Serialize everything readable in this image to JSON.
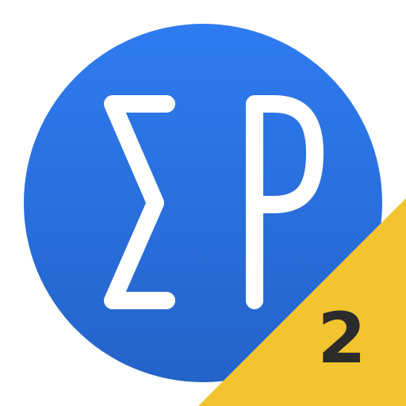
{
  "app_icon": {
    "logo_text": "ΣP",
    "badge_number": "2",
    "colors": {
      "circle_top": "#2f7bf0",
      "circle_bottom": "#2463c9",
      "glyph": "#ffffff",
      "corner_ribbon": "#f2c530",
      "badge_text": "#2b2b2b",
      "background": "#ffffff"
    }
  }
}
